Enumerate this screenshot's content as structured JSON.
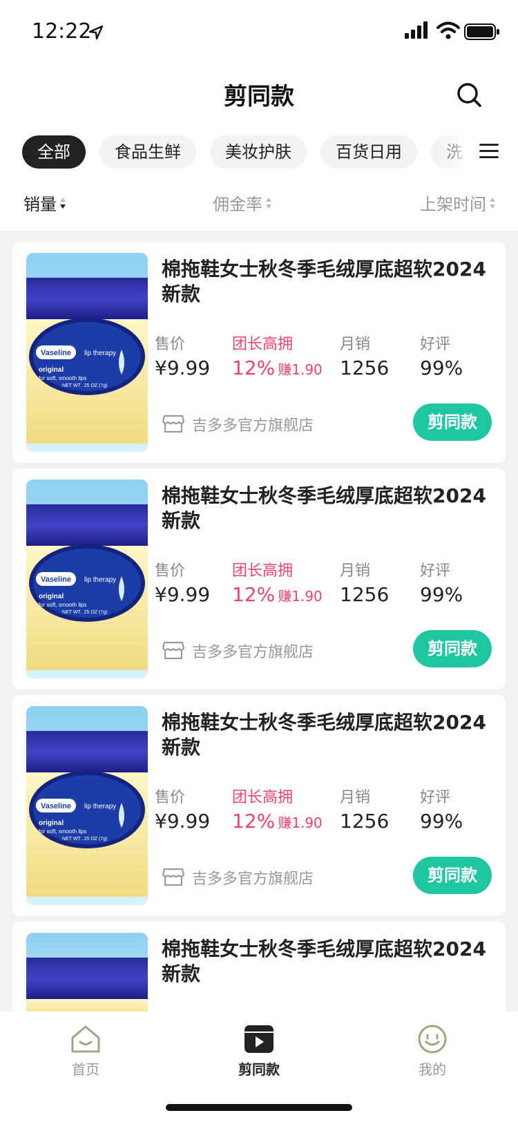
{
  "status_bar": {
    "time": "12:22"
  },
  "header": {
    "title": "剪同款"
  },
  "categories": [
    "全部",
    "食品生鲜",
    "美妆护肤",
    "百货日用",
    "洗"
  ],
  "sort": {
    "sales": "销量",
    "commission_rate": "佣金率",
    "listing_time": "上架时间"
  },
  "stat_labels": {
    "price": "售价",
    "commission": "团长高拥",
    "monthly_sales": "月销",
    "rating": "好评"
  },
  "products": [
    {
      "title": "棉拖鞋女士秋冬季毛绒厚底超软2024新款",
      "price": "¥9.99",
      "commission_rate": "12%",
      "earn": "赚1.90",
      "monthly_sales": "1256",
      "rating": "99%",
      "store": "吉多多官方旗舰店",
      "cta": "剪同款"
    },
    {
      "title": "棉拖鞋女士秋冬季毛绒厚底超软2024新款",
      "price": "¥9.99",
      "commission_rate": "12%",
      "earn": "赚1.90",
      "monthly_sales": "1256",
      "rating": "99%",
      "store": "吉多多官方旗舰店",
      "cta": "剪同款"
    },
    {
      "title": "棉拖鞋女士秋冬季毛绒厚底超软2024新款",
      "price": "¥9.99",
      "commission_rate": "12%",
      "earn": "赚1.90",
      "monthly_sales": "1256",
      "rating": "99%",
      "store": "吉多多官方旗舰店",
      "cta": "剪同款"
    },
    {
      "title": "棉拖鞋女士秋冬季毛绒厚底超软2024新款"
    }
  ],
  "product_image_text": {
    "brand": "Vaseline",
    "line": "lip therapy",
    "variant": "original",
    "desc": "for soft, smooth lips",
    "net": "NET WT. .25 OZ (7g)"
  },
  "tabbar": [
    {
      "label": "首页",
      "icon": "home-icon"
    },
    {
      "label": "剪同款",
      "icon": "video-play-icon",
      "active": true
    },
    {
      "label": "我的",
      "icon": "smiley-icon"
    }
  ],
  "colors": {
    "accent": "#1fc7a0",
    "highlight": "#f0436b",
    "chip_active": "#222222"
  }
}
